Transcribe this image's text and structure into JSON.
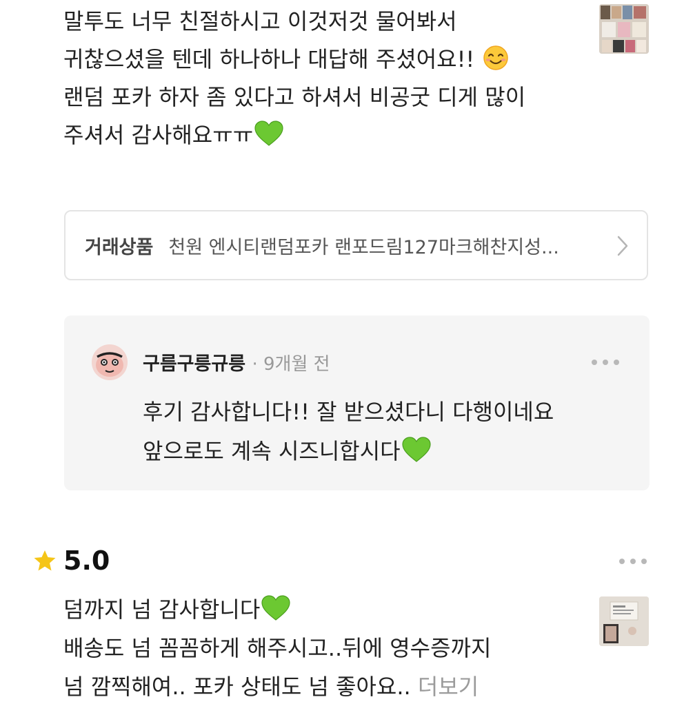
{
  "review1": {
    "lines": [
      "말투도 너무 친절하시고 이것저것 물어봐서",
      "귀찮으셨을 텐데 하나하나 대답해 주셨어요!!",
      "랜덤 포카 하자 좀 있다고 하셔서 비공굿 디게 많이",
      "주셔서 감사해요ㅠㅠ"
    ],
    "emoji_line2": "smiling-face-emoji",
    "emoji_line4": "green-heart-emoji"
  },
  "product": {
    "label": "거래상품",
    "name": "천원 엔시티랜덤포카 랜포드림127마크해찬지성..."
  },
  "reply": {
    "author": "구름구릉규릉",
    "meta": "· 9개월 전",
    "lines": [
      "후기 감사합니다!! 잘 받으셨다니 다행이네요",
      "앞으로도 계속 시즈니합시다"
    ]
  },
  "review2": {
    "score": "5.0",
    "lines": [
      "덤까지 넘 감사합니다",
      "배송도 넘 꼼꼼하게 해주시고..뒤에 영수증까지",
      "넘 깜찍해여.. 포카 상태도 넘 좋아요.. "
    ],
    "more_label": "더보기"
  },
  "colors": {
    "star": "#f5c518",
    "heart": "#6cc832",
    "reply_bg": "#f5f5f5",
    "border": "#e4e4e4"
  },
  "icons": [
    "star-icon",
    "chevron-right-icon",
    "more-options-icon",
    "green-heart-emoji",
    "smiling-face-emoji"
  ]
}
